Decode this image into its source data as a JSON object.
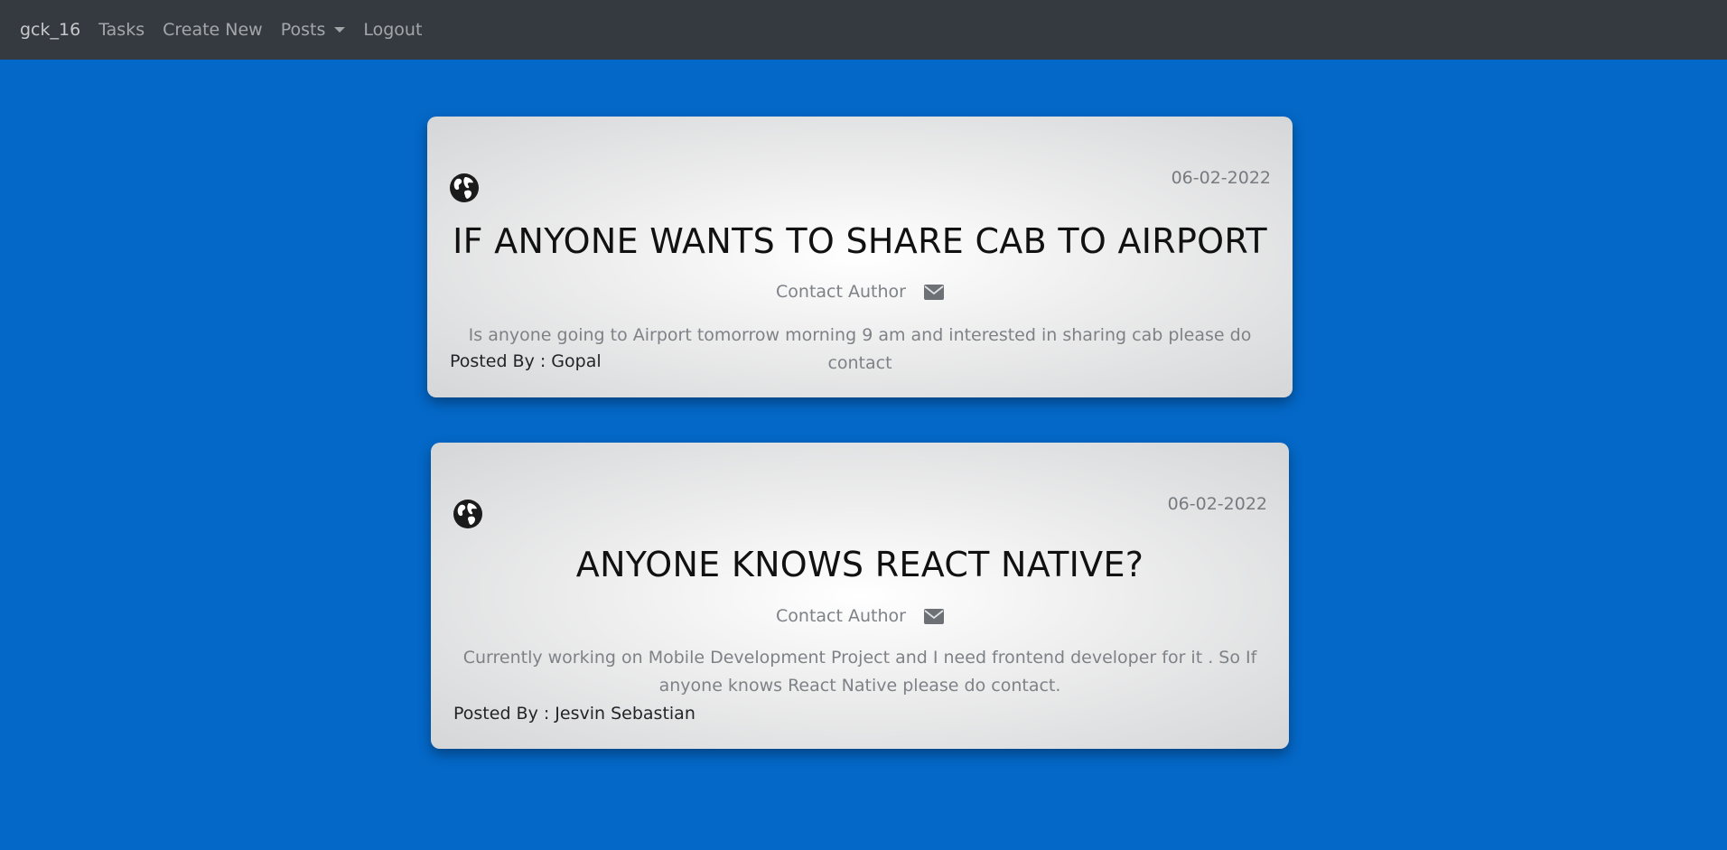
{
  "nav": {
    "brand": "gck_16",
    "tasks": "Tasks",
    "create_new": "Create New",
    "posts": "Posts",
    "logout": "Logout"
  },
  "posts": [
    {
      "date": "06-02-2022",
      "title": "IF ANYONE WANTS TO SHARE CAB TO AIRPORT",
      "contact_label": "Contact Author",
      "description": "Is anyone going to Airport tomorrow morning 9 am and interested in sharing cab please do contact",
      "posted_by": "Posted By : Gopal",
      "icon": "globe-icon"
    },
    {
      "date": "06-02-2022",
      "title": "ANYONE KNOWS REACT NATIVE?",
      "contact_label": "Contact Author",
      "description": "Currently working on Mobile Development Project and I need frontend developer for it . So If anyone knows React Native please do contact.",
      "posted_by": "Posted By : Jesvin Sebastian",
      "icon": "globe-icon"
    }
  ],
  "colors": {
    "page_background": "#0468c8",
    "navbar": "#343a40"
  }
}
